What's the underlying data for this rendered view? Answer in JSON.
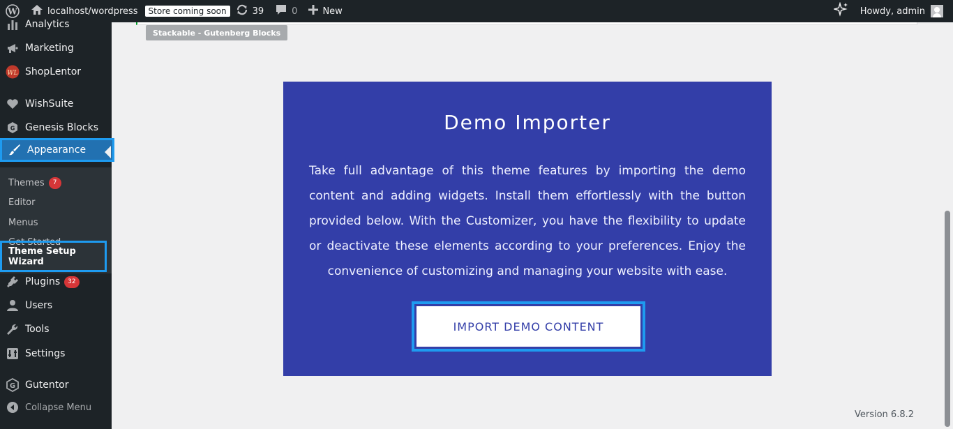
{
  "adminbar": {
    "site": "localhost/wordpress",
    "store_badge": "Store coming soon",
    "updates_count": "39",
    "comments_count": "0",
    "new_label": "New",
    "howdy": "Howdy, admin"
  },
  "sidebar": {
    "items": [
      {
        "label": "Analytics",
        "icon": "bar-chart-icon"
      },
      {
        "label": "Marketing",
        "icon": "megaphone-icon"
      },
      {
        "label": "ShopLentor",
        "icon": "shoplentor-logo-icon"
      },
      {
        "label": "WishSuite",
        "icon": "heart-icon"
      },
      {
        "label": "Genesis Blocks",
        "icon": "genesis-icon"
      },
      {
        "label": "Appearance",
        "icon": "paintbrush-icon"
      },
      {
        "label": "Plugins",
        "icon": "plug-icon",
        "badge": "32"
      },
      {
        "label": "Users",
        "icon": "user-icon"
      },
      {
        "label": "Tools",
        "icon": "wrench-icon"
      },
      {
        "label": "Settings",
        "icon": "settings-sliders-icon"
      },
      {
        "label": "Gutentor",
        "icon": "gutentor-icon"
      }
    ],
    "submenu": [
      {
        "label": "Themes",
        "badge": "7"
      },
      {
        "label": "Editor"
      },
      {
        "label": "Menus"
      },
      {
        "label": "Get Started"
      },
      {
        "label": "Theme Setup Wizard"
      }
    ],
    "collapse_label": "Collapse Menu"
  },
  "content": {
    "tag": "Stackable - Gutenberg Blocks",
    "demo": {
      "title": "Demo Importer",
      "text": "Take full advantage of this theme features by importing the demo content and adding widgets. Install them effortlessly with the button provided below. With the Customizer, you have the flexibility to update or deactivate these elements according to your preferences. Enjoy the convenience of customizing and managing your website with ease.",
      "button": "IMPORT DEMO CONTENT"
    },
    "version": "Version 6.8.2"
  },
  "colors": {
    "admin_dark": "#1d2327",
    "active_blue": "#2271b1",
    "highlight": "#1e9bf0",
    "demo_bg": "#333ea8"
  }
}
